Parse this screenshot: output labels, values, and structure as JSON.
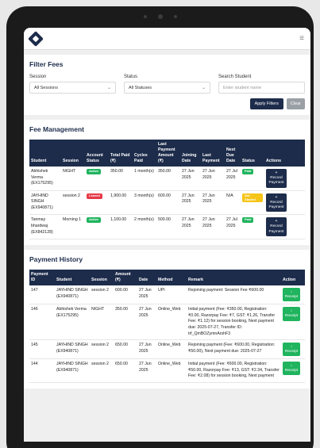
{
  "colors": {
    "primary": "#1d2c4b",
    "active": "#20b45e",
    "left": "#e63946",
    "paid": "#20b45e",
    "not_started": "#f5c518",
    "receipt": "#20b45e"
  },
  "icons": {
    "logo": "brand-logo-icon",
    "menu": "hamburger-menu-icon",
    "chevron": "chevron-down-icon",
    "download": "download-icon"
  },
  "menu_glyph": "≡",
  "filter": {
    "title": "Filter Fees",
    "session_label": "Session",
    "session_value": "All Sessions",
    "status_label": "Status",
    "status_value": "All Statuses",
    "search_label": "Search Student",
    "search_placeholder": "Enter student name",
    "apply_label": "Apply Filters",
    "clear_label": "Clear"
  },
  "fees": {
    "title": "Fee Management",
    "headers": [
      "Student",
      "Session",
      "Account Status",
      "Total Paid (₹)",
      "Cycles Paid",
      "Last Payment Amount (₹)",
      "Joining Date",
      "Last Payment",
      "Next Due Date",
      "Status",
      "Actions"
    ],
    "rows": [
      {
        "student": "Abhishek Verma (EX175295)",
        "session": "NIGHT",
        "account_status": "Active",
        "total_paid": "350.00",
        "cycles": "1 month(s)",
        "last_amount": "350.00",
        "joining": "27 Jun 2025",
        "last_payment": "27 Jun 2025",
        "next_due": "27 Jul 2025",
        "status": "Paid",
        "action": "Record Payment"
      },
      {
        "student": "JAYHIND SINGH (EX940871)",
        "session": "session 2",
        "account_status": "Leaved",
        "total_paid": "1,900.00",
        "cycles": "3 month(s)",
        "last_amount": "600.00",
        "joining": "27 Jun 2025",
        "last_payment": "27 Jun 2025",
        "next_due": "N/A",
        "status": "Not Started",
        "action": "Record Payment"
      },
      {
        "student": "Tanmay bhardwaj (EX842128)",
        "session": "Morning 1",
        "account_status": "Active",
        "total_paid": "1,100.00",
        "cycles": "2 month(s)",
        "last_amount": "500.00",
        "joining": "27 Jun 2025",
        "last_payment": "27 Jun 2025",
        "next_due": "27 Jul 2025",
        "status": "Paid",
        "action": "Record Payment"
      }
    ]
  },
  "history": {
    "title": "Payment History",
    "headers": [
      "Payment ID",
      "Student",
      "Session",
      "Amount (₹)",
      "Date",
      "Method",
      "Remark",
      "Action"
    ],
    "rows": [
      {
        "id": "147",
        "student": "JAYHIND SINGH (EX940871)",
        "session": "session 2",
        "amount": "600.00",
        "date": "27 Jun 2025",
        "method": "UPI",
        "remark": "Rejoining payment: Session Fee ₹600.00",
        "action": "Receipt"
      },
      {
        "id": "146",
        "student": "Abhishek Verma (EX175295)",
        "session": "NIGHT",
        "amount": "350.00",
        "date": "27 Jun 2025",
        "method": "Online_Web",
        "remark": "Initial payment (Fee: ₹350.00, Registration: ₹0.00, Razorpay Fee: ₹7, GST: ₹1.26, Transfer Fee: ₹1.12) for session booking, Next payment due: 2025-07-27, Transfer ID: trf_QmBOZymnArshF3",
        "action": "Receipt"
      },
      {
        "id": "145",
        "student": "JAYHIND SINGH (EX940871)",
        "session": "session 2",
        "amount": "650.00",
        "date": "27 Jun 2025",
        "method": "Online_Web",
        "remark": "Rejoining payment (Fee: ₹600.00, Registration: ₹50.00), Next payment due: 2025-07-27",
        "action": "Receipt"
      },
      {
        "id": "144",
        "student": "JAYHIND SINGH (EX940871)",
        "session": "session 2",
        "amount": "650.00",
        "date": "27 Jun 2025",
        "method": "Online_Web",
        "remark": "Initial payment (Fee: ₹600.00, Registration: ₹50.00, Razorpay Fee: ₹13, GST: ₹2.34, Transfer Fee: ₹2.08) for session booking, Next payment",
        "action": "Receipt"
      }
    ]
  }
}
